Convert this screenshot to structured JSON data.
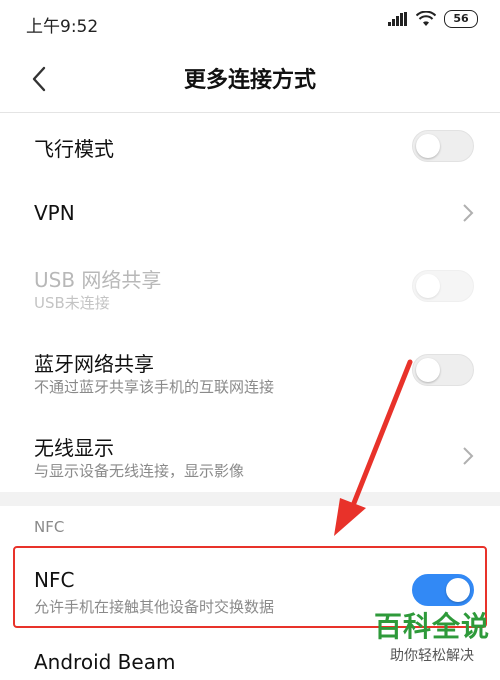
{
  "status": {
    "time": "上午9:52",
    "battery": "56"
  },
  "nav": {
    "title": "更多连接方式"
  },
  "rows": {
    "airplane": {
      "title": "飞行模式",
      "on": false
    },
    "vpn": {
      "title": "VPN"
    },
    "usb": {
      "title": "USB 网络共享",
      "subtitle": "USB未连接",
      "on": false,
      "disabled": true
    },
    "bluetooth": {
      "title": "蓝牙网络共享",
      "subtitle": "不通过蓝牙共享该手机的互联网连接",
      "on": false
    },
    "wireless_display": {
      "title": "无线显示",
      "subtitle": "与显示设备无线连接，显示影像"
    },
    "nfc": {
      "title": "NFC",
      "subtitle": "允许手机在接触其他设备时交换数据",
      "on": true
    },
    "android_beam": {
      "title": "Android Beam"
    }
  },
  "section": {
    "nfc_header": "NFC"
  },
  "colors": {
    "accent": "#3289f5",
    "annotation_red": "#e8322a",
    "watermark_green": "#2e9a3a"
  },
  "watermark": {
    "title": "百科全说",
    "subtitle": "助你轻松解决"
  }
}
